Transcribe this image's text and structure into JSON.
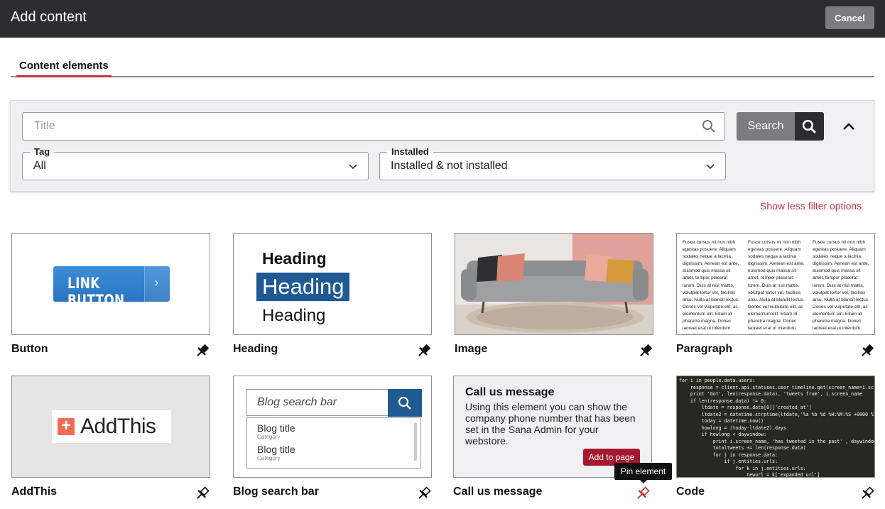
{
  "header": {
    "title": "Add content",
    "cancel_label": "Cancel"
  },
  "tabs": [
    {
      "label": "Content elements"
    }
  ],
  "filter": {
    "title_placeholder": "Title",
    "search_label": "Search",
    "tag": {
      "label": "Tag",
      "value": "All"
    },
    "installed": {
      "label": "Installed",
      "value": "Installed & not installed"
    },
    "less_options_label": "Show less filter options"
  },
  "cards": [
    {
      "name": "Button",
      "preview": {
        "button_text": "LINK BUTTON",
        "chevron": "›"
      }
    },
    {
      "name": "Heading",
      "preview": {
        "h1": "Heading",
        "h2": "Heading",
        "h3": "Heading"
      }
    },
    {
      "name": "Image",
      "preview": {
        "subject": "sofa-photo"
      }
    },
    {
      "name": "Paragraph",
      "preview": {
        "col1": "Fusce cursus mi non nibh egestas posuere. Aliquam sodales neque a lacinia dignissim. Aenean est ante, euismod quis massa sit amet, tempor placerat lorem. Duis at nisl mattis, volutpat tortor vel, facilisis arcu. Nulla at blandit lectus. Donec vel vulputate elit, ac elementum elit. Etiam id pharetra magna. Donec laoreet erat ut interdum accumsan.",
        "col2": "Fusce cursus mi non nibh egestas posuere. Aliquam sodales neque a lacinia dignissim. Aenean est ante, euismod quis massa sit amet, tempor placerat lorem. Duis at nisl mattis, volutpat tortor vel, facilisis arcu. Nulla at blandit lectus. Donec vel vulputate elit, ac elementum elit. Etiam id pharetra magna. Donec laoreet erat ut interdum accumsan.",
        "col3": "Fusce cursus mi non nibh egestas posuere. Aliquam sodales neque a lacinia dignissim. Aenean est ante, euismod quis massa sit amet, tempor placerat lorem. Duis at nisl mattis, volutpat tortor vel, facilisis arcu. Nulla at blandit lectus. Donec vel vulputate elit, ac elementum elit. Etiam id pharetra magna. Donec laoreet erat ut interdum accumsan."
      }
    },
    {
      "name": "AddThis",
      "preview": {
        "plus": "+",
        "text": "AddThis"
      }
    },
    {
      "name": "Blog search bar",
      "preview": {
        "placeholder": "Blog search bar",
        "items": [
          {
            "title": "Blog title",
            "category": "Category"
          },
          {
            "title": "Blog title",
            "category": "Category"
          }
        ]
      }
    },
    {
      "name": "Call us message",
      "preview": {
        "title": "Call us message",
        "body": "Using this element you can show the company phone number that has been set in the Sana Admin for your webstore.",
        "add_label": "Add to page"
      }
    },
    {
      "name": "Code",
      "preview": {
        "code": "for i in people.data.users:\n    response = client.api.statuses.user_timeline.get(screen_name=i.scre\n    print 'Got', len(response.data), 'tweets from', i.screen_name\n    if len(response.data) != 0:\n        ltdate = response.data[0]['created_at']\n        ltdate2 = datetime.strptime(ltdate,'%a %b %d %H:%M:%S +0000 %Y')\n        today = datetime.now()\n        howlong = (today-ltdate2).days\n        if howlong < daywindow:\n            print i.screen_name, 'has tweeted in the past' , daywindow,\n            totaltweets += len(response.data)\n            for j in response.data:\n                if j.entities.urls:\n                    for k in j.entities.urls:\n                        newurl = k['expanded_url']\n                        urlset.add((newurl, j.user.screen_name))\n        else:"
      }
    }
  ],
  "tooltip": "Pin element",
  "colors": {
    "accent": "#c8313f",
    "dark": "#2d2d30",
    "blue": "#1f5a93"
  },
  "icons": {
    "pin": "pin-icon",
    "search": "search-icon",
    "chevron": "chevron-down-icon",
    "collapse": "chevron-up-icon"
  }
}
